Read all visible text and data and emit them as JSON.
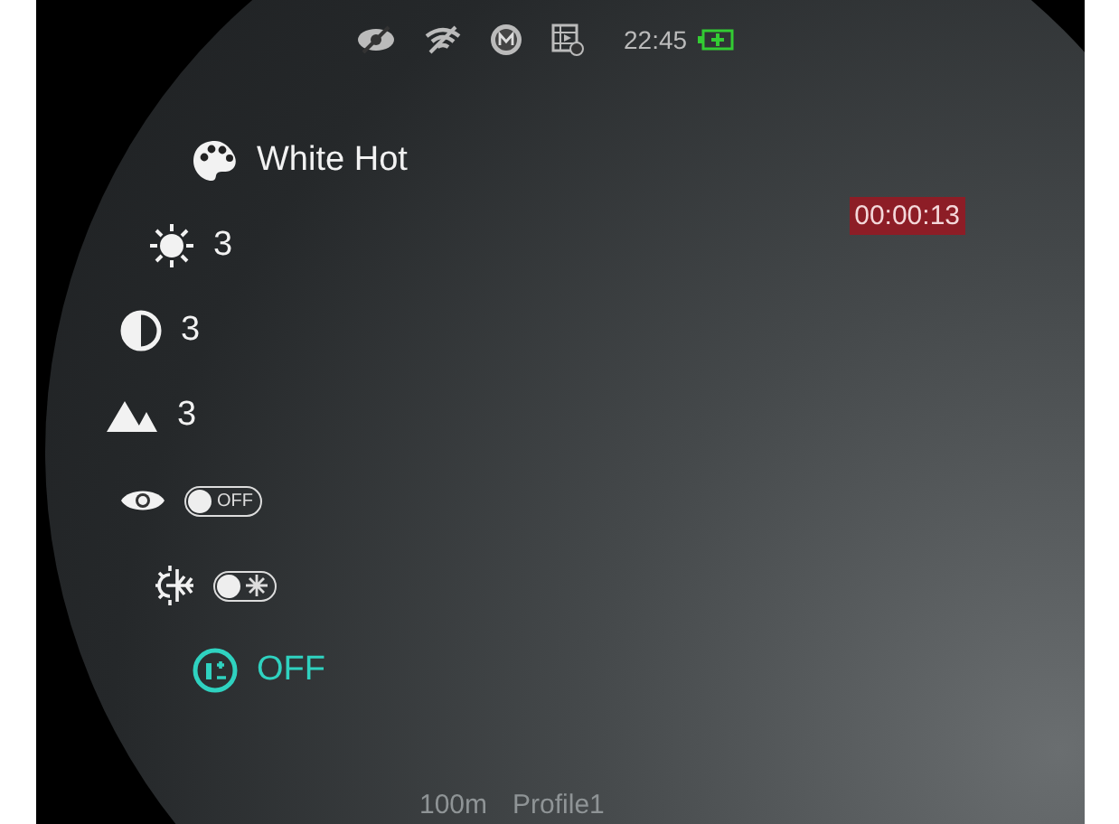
{
  "status_bar": {
    "time": "22:45",
    "battery_charging": true
  },
  "recording_timer": "00:00:13",
  "menu": [
    {
      "kind": "value",
      "label": "White Hot",
      "selected": false
    },
    {
      "kind": "value",
      "label": "3",
      "selected": false
    },
    {
      "kind": "value",
      "label": "3",
      "selected": false
    },
    {
      "kind": "value",
      "label": "3",
      "selected": false
    },
    {
      "kind": "toggle",
      "on": false,
      "toggle_label": "OFF",
      "selected": false
    },
    {
      "kind": "toggle",
      "on": false,
      "selected": false
    },
    {
      "kind": "value",
      "label": "OFF",
      "selected": true
    }
  ],
  "footer": {
    "distance": "100m",
    "profile": "Profile1"
  }
}
